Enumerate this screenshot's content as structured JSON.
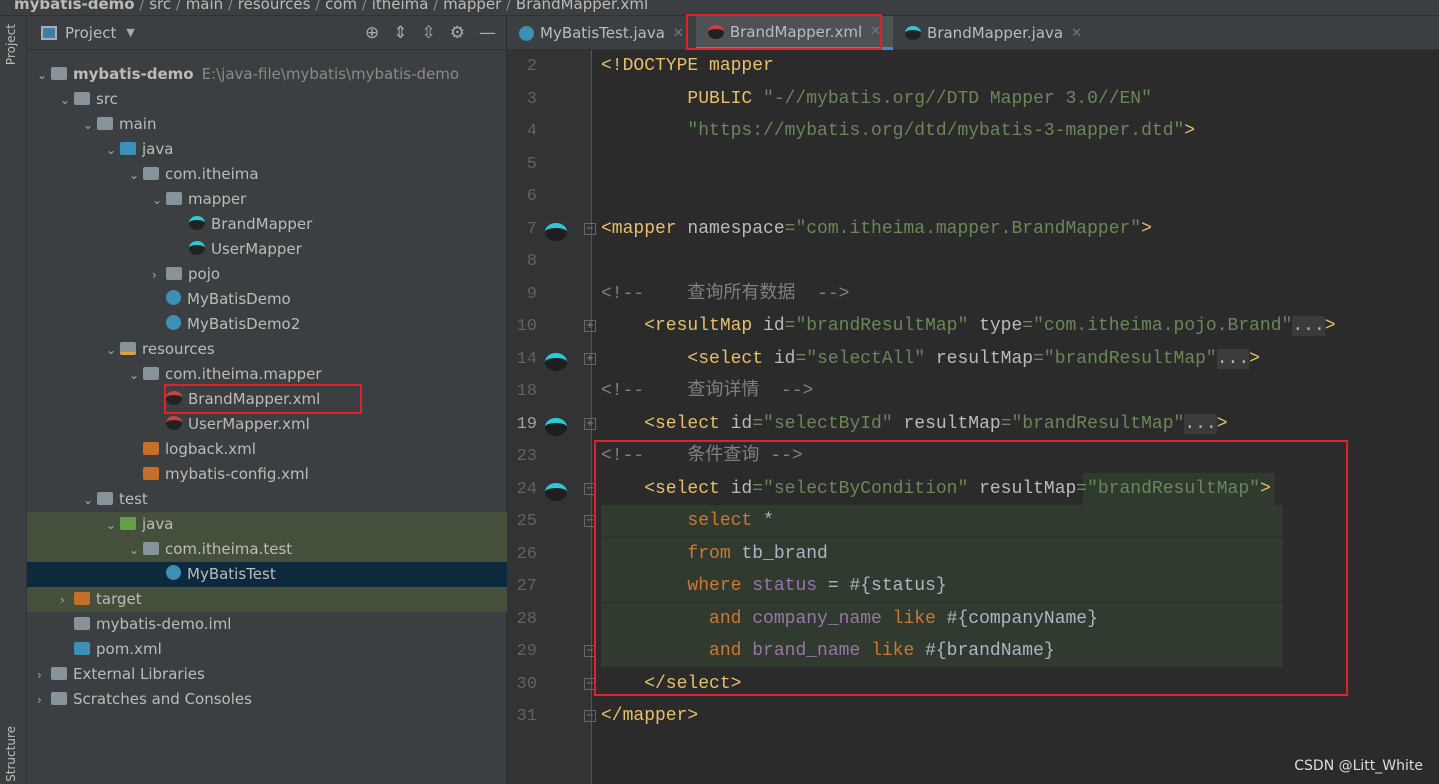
{
  "breadcrumb": [
    "mybatis-demo",
    "src",
    "main",
    "resources",
    "com",
    "itheima",
    "mapper",
    "BrandMapper.xml"
  ],
  "sidebar_tabs": {
    "project": "Project",
    "structure": "Structure"
  },
  "project_panel": {
    "title": "Project",
    "tools": [
      "locate-icon",
      "expand-icon",
      "collapse-icon",
      "gear-icon",
      "minimize-icon"
    ]
  },
  "tree": [
    {
      "label": "mybatis-demo",
      "path": "E:\\java-file\\mybatis\\mybatis-demo",
      "depth": 0,
      "arrow": "down",
      "icon": "folder",
      "bold": true
    },
    {
      "label": "src",
      "depth": 1,
      "arrow": "down",
      "icon": "folder"
    },
    {
      "label": "main",
      "depth": 2,
      "arrow": "down",
      "icon": "folder"
    },
    {
      "label": "java",
      "depth": 3,
      "arrow": "down",
      "icon": "folder blue"
    },
    {
      "label": "com.itheima",
      "depth": 4,
      "arrow": "down",
      "icon": "folder"
    },
    {
      "label": "mapper",
      "depth": 5,
      "arrow": "down",
      "icon": "folder"
    },
    {
      "label": "BrandMapper",
      "depth": 6,
      "icon": "bird"
    },
    {
      "label": "UserMapper",
      "depth": 6,
      "icon": "bird"
    },
    {
      "label": "pojo",
      "depth": 5,
      "arrow": "right",
      "icon": "folder"
    },
    {
      "label": "MyBatisDemo",
      "depth": 5,
      "icon": "cls"
    },
    {
      "label": "MyBatisDemo2",
      "depth": 5,
      "icon": "cls"
    },
    {
      "label": "resources",
      "depth": 3,
      "arrow": "down",
      "icon": "folder res"
    },
    {
      "label": "com.itheima.mapper",
      "depth": 4,
      "arrow": "down",
      "icon": "folder"
    },
    {
      "label": "BrandMapper.xml",
      "depth": 5,
      "icon": "xml",
      "boxed": true
    },
    {
      "label": "UserMapper.xml",
      "depth": 5,
      "icon": "xml"
    },
    {
      "label": "logback.xml",
      "depth": 4,
      "icon": "xmlf"
    },
    {
      "label": "mybatis-config.xml",
      "depth": 4,
      "icon": "xmlf"
    },
    {
      "label": "test",
      "depth": 2,
      "arrow": "down",
      "icon": "folder"
    },
    {
      "label": "java",
      "depth": 3,
      "arrow": "down",
      "icon": "folder green",
      "hl": true
    },
    {
      "label": "com.itheima.test",
      "depth": 4,
      "arrow": "down",
      "icon": "folder",
      "hl": true
    },
    {
      "label": "MyBatisTest",
      "depth": 5,
      "icon": "cls",
      "sel": true
    },
    {
      "label": "target",
      "depth": 1,
      "arrow": "right",
      "icon": "folder orange",
      "hl": true
    },
    {
      "label": "mybatis-demo.iml",
      "depth": 1,
      "icon": "folder"
    },
    {
      "label": "pom.xml",
      "depth": 1,
      "icon": "folder blue"
    },
    {
      "label": "External Libraries",
      "depth": 0,
      "arrow": "right",
      "icon": "folder"
    },
    {
      "label": "Scratches and Consoles",
      "depth": 0,
      "arrow": "right",
      "icon": "folder"
    }
  ],
  "tabs": [
    {
      "label": "MyBatisTest.java",
      "icon": "cls",
      "active": false
    },
    {
      "label": "BrandMapper.xml",
      "icon": "xml",
      "active": true
    },
    {
      "label": "BrandMapper.java",
      "icon": "bird",
      "active": false
    }
  ],
  "code": [
    {
      "n": "2",
      "tokens": [
        [
          "<!DOCTYPE mapper",
          "t"
        ]
      ]
    },
    {
      "n": "3",
      "tokens": [
        [
          "        PUBLIC ",
          "t"
        ],
        [
          "\"-//mybatis.org//DTD Mapper 3.0//EN\"",
          "v"
        ]
      ]
    },
    {
      "n": "4",
      "tokens": [
        [
          "        \"https://mybatis.org/dtd/mybatis-3-mapper.dtd\"",
          "v"
        ],
        [
          ">",
          "t"
        ]
      ]
    },
    {
      "n": "5",
      "tokens": []
    },
    {
      "n": "6",
      "tokens": []
    },
    {
      "n": "7",
      "gicon": true,
      "fold": "-",
      "tokens": [
        [
          "<mapper ",
          "t"
        ],
        [
          "namespace",
          "a"
        ],
        [
          "=\"com.itheima.mapper.BrandMapper\"",
          "v"
        ],
        [
          ">",
          "t"
        ]
      ]
    },
    {
      "n": "8",
      "tokens": []
    },
    {
      "n": "9",
      "tokens": [
        [
          "<!--    查询所有数据  -->",
          "c"
        ]
      ]
    },
    {
      "n": "10",
      "fold": "+",
      "tokens": [
        [
          "    <resultMap ",
          "t"
        ],
        [
          "id",
          "a"
        ],
        [
          "=\"brandResultMap\" ",
          "v"
        ],
        [
          "type",
          "a"
        ],
        [
          "=\"com.itheima.pojo.Brand\"",
          "v"
        ],
        [
          "...",
          "d"
        ],
        [
          ">",
          "t"
        ]
      ]
    },
    {
      "n": "14",
      "gicon": true,
      "fold": "+",
      "tokens": [
        [
          "        <select ",
          "t"
        ],
        [
          "id",
          "a"
        ],
        [
          "=\"selectAll\" ",
          "v"
        ],
        [
          "resultMap",
          "a"
        ],
        [
          "=\"brandResultMap\"",
          "v"
        ],
        [
          "...",
          "d"
        ],
        [
          ">",
          "t"
        ]
      ]
    },
    {
      "n": "18",
      "tokens": [
        [
          "<!--    查询详情  -->",
          "c"
        ]
      ]
    },
    {
      "n": "19",
      "gicon": true,
      "fold": "+",
      "cur": true,
      "tokens": [
        [
          "    <select ",
          "t"
        ],
        [
          "id",
          "a"
        ],
        [
          "=\"selectById\" ",
          "v"
        ],
        [
          "resultMap",
          "a"
        ],
        [
          "=\"brandResultMap\"",
          "v"
        ],
        [
          "...",
          "d"
        ],
        [
          ">",
          "t"
        ]
      ]
    },
    {
      "n": "23",
      "tokens": [
        [
          "<!--    条件查询 -->",
          "c"
        ]
      ]
    },
    {
      "n": "24",
      "gicon": true,
      "fold": "-",
      "tokens": [
        [
          "    <select ",
          "t"
        ],
        [
          "id",
          "a"
        ],
        [
          "=\"selectByCondition\" ",
          "v"
        ],
        [
          "resultMap",
          "a"
        ],
        [
          "=\"brandResultMap\"",
          "v"
        ],
        [
          ">",
          "t"
        ]
      ]
    },
    {
      "n": "25",
      "fold": "-",
      "sql": true,
      "tokens": [
        [
          "        select ",
          "k"
        ],
        [
          "*",
          "n"
        ]
      ]
    },
    {
      "n": "26",
      "sql": true,
      "tokens": [
        [
          "        from ",
          "k"
        ],
        [
          "tb_brand",
          "n"
        ]
      ]
    },
    {
      "n": "27",
      "sql": true,
      "tokens": [
        [
          "        where ",
          "k"
        ],
        [
          "status",
          "p"
        ],
        [
          " = #{status}",
          "n"
        ]
      ]
    },
    {
      "n": "28",
      "sql": true,
      "tokens": [
        [
          "          and ",
          "k"
        ],
        [
          "company_name",
          "p"
        ],
        [
          " like ",
          "k"
        ],
        [
          "#{companyName}",
          "n"
        ]
      ]
    },
    {
      "n": "29",
      "fold": "-",
      "sql": true,
      "tokens": [
        [
          "          and ",
          "k"
        ],
        [
          "brand_name",
          "p"
        ],
        [
          " like ",
          "k"
        ],
        [
          "#{brandName}",
          "n"
        ]
      ]
    },
    {
      "n": "30",
      "fold": "-",
      "tokens": [
        [
          "    </select>",
          "t"
        ]
      ]
    },
    {
      "n": "31",
      "fold": "-",
      "tokens": [
        [
          "</mapper>",
          "t"
        ]
      ]
    }
  ],
  "watermark": "CSDN @Litt_White",
  "colors": {
    "editor_bg": "#2b2b2b",
    "panel_bg": "#3c3f41",
    "highlight_box": "#e0202a",
    "selection": "#0d293e"
  }
}
